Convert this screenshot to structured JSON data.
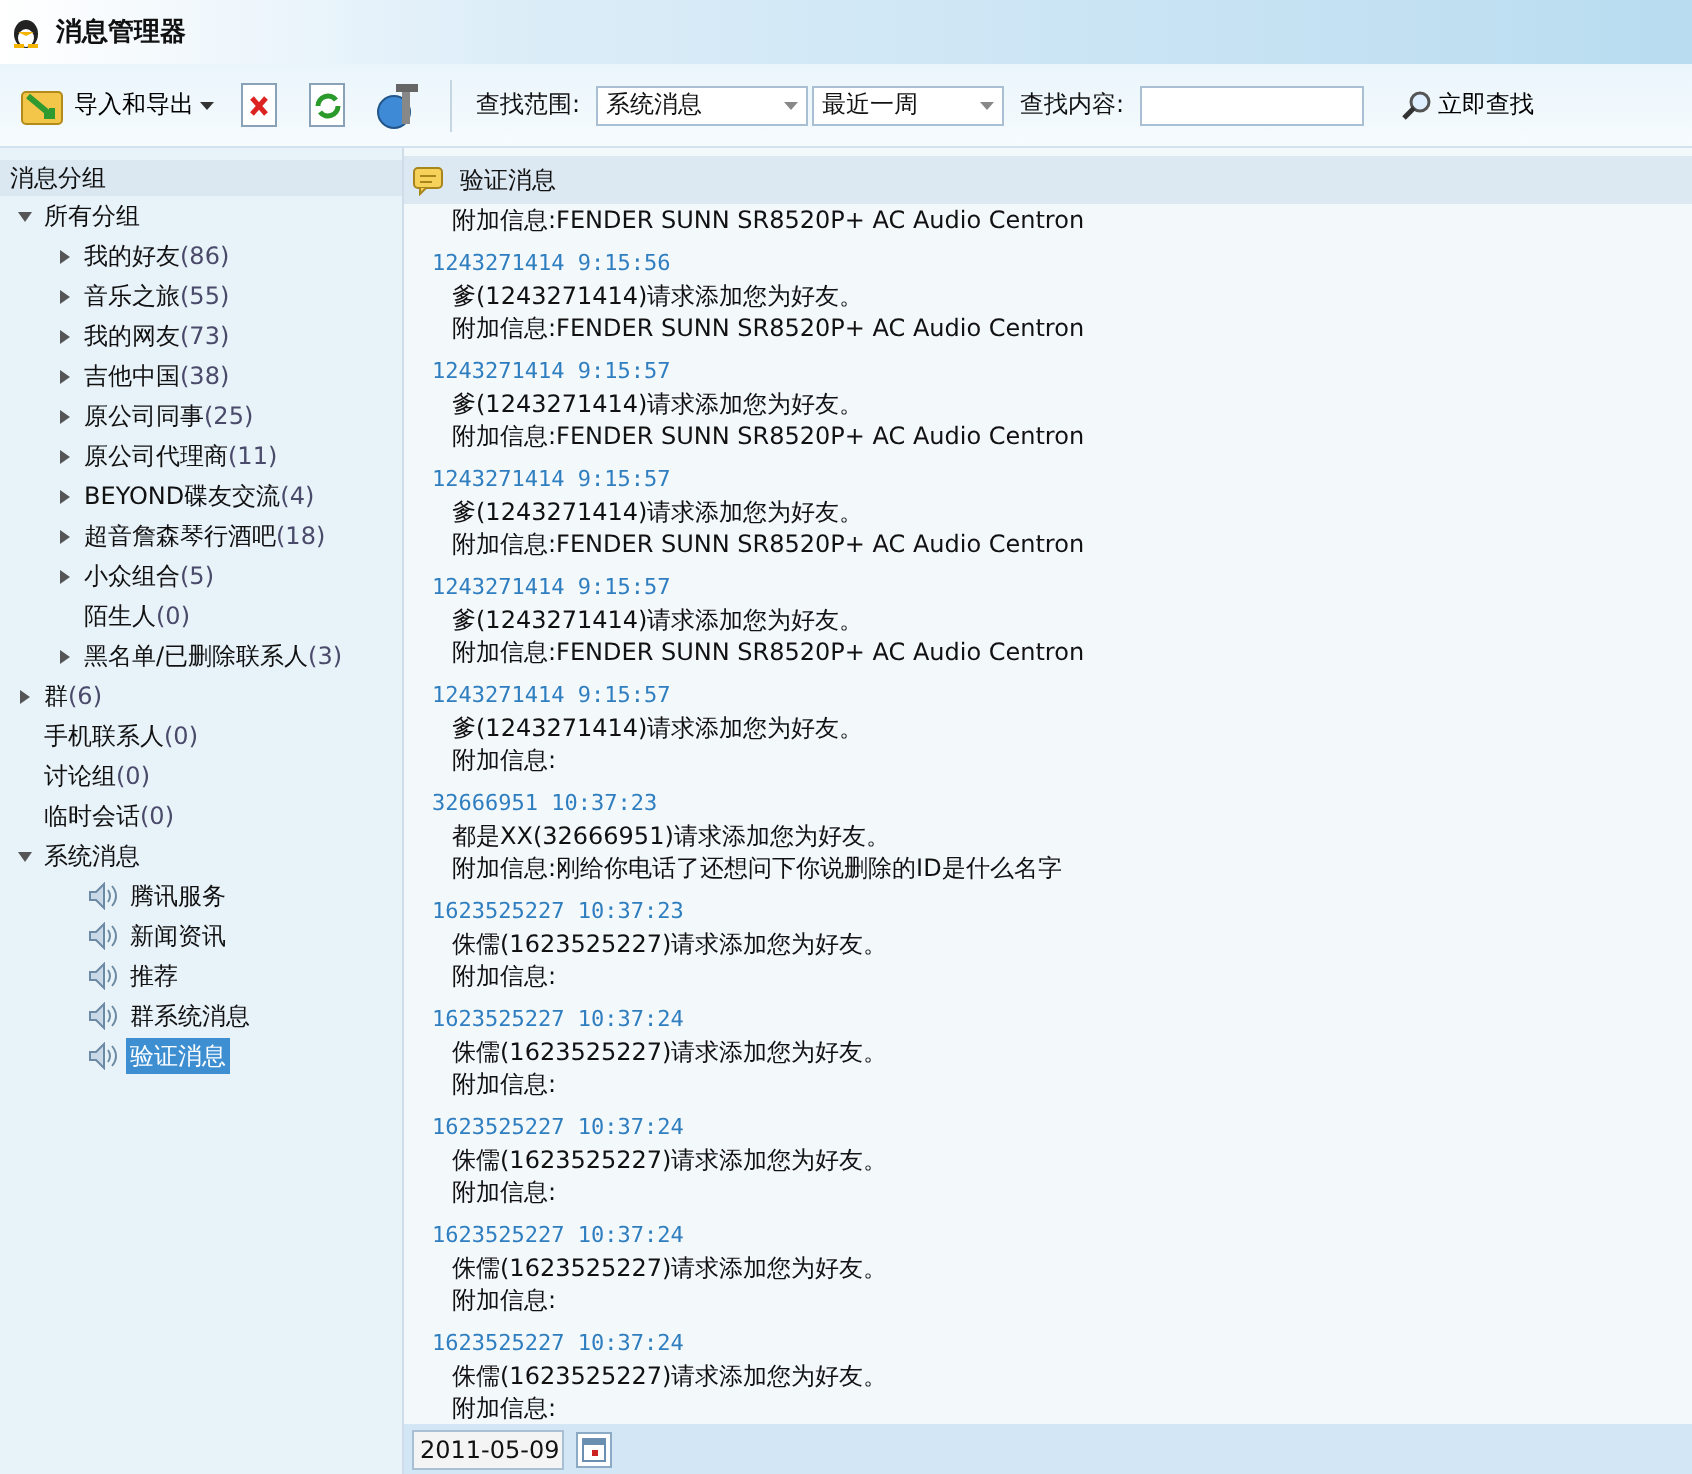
{
  "window": {
    "title": "消息管理器"
  },
  "toolbar": {
    "import_export": "导入和导出",
    "scope_label": "查找范围:",
    "scope_value": "系统消息",
    "period_value": "最近一周",
    "content_label": "查找内容:",
    "search_button": "立即查找"
  },
  "sidebar": {
    "title": "消息分组",
    "items": [
      {
        "kind": "group",
        "label": "所有分组",
        "expanded": true,
        "children": [
          {
            "kind": "group",
            "label": "我的好友",
            "count": "(86)",
            "expanded": false
          },
          {
            "kind": "group",
            "label": "音乐之旅",
            "count": "(55)",
            "expanded": false
          },
          {
            "kind": "group",
            "label": "我的网友",
            "count": "(73)",
            "expanded": false
          },
          {
            "kind": "group",
            "label": "吉他中国",
            "count": "(38)",
            "expanded": false
          },
          {
            "kind": "group",
            "label": "原公司同事",
            "count": "(25)",
            "expanded": false
          },
          {
            "kind": "group",
            "label": "原公司代理商",
            "count": "(11)",
            "expanded": false
          },
          {
            "kind": "group",
            "label": "BEYOND碟友交流",
            "count": "(4)",
            "expanded": false
          },
          {
            "kind": "group",
            "label": "超音詹森琴行酒吧",
            "count": "(18)",
            "expanded": false
          },
          {
            "kind": "group",
            "label": "小众组合",
            "count": "(5)",
            "expanded": false
          },
          {
            "kind": "plain",
            "label": "陌生人",
            "count": "(0)"
          },
          {
            "kind": "group",
            "label": "黑名单/已删除联系人",
            "count": "(3)",
            "expanded": false
          }
        ]
      },
      {
        "kind": "group",
        "label": "群",
        "count": "(6)",
        "expanded": false
      },
      {
        "kind": "plain",
        "label": "手机联系人",
        "count": "(0)"
      },
      {
        "kind": "plain",
        "label": "讨论组",
        "count": "(0)"
      },
      {
        "kind": "plain",
        "label": "临时会话",
        "count": "(0)"
      },
      {
        "kind": "group",
        "label": "系统消息",
        "expanded": true,
        "children": [
          {
            "kind": "channel",
            "label": "腾讯服务",
            "selected": false
          },
          {
            "kind": "channel",
            "label": "新闻资讯",
            "selected": false
          },
          {
            "kind": "channel",
            "label": "推荐",
            "selected": false
          },
          {
            "kind": "channel",
            "label": "群系统消息",
            "selected": false
          },
          {
            "kind": "channel",
            "label": "验证消息",
            "selected": true
          }
        ]
      }
    ]
  },
  "panel": {
    "title": "验证消息",
    "messages": [
      {
        "extra": "附加信息:FENDER SUNN SR8520P+ AC Audio Centron"
      },
      {
        "header": "1243271414  9:15:56",
        "request": "爹(1243271414)请求添加您为好友。",
        "extra": "附加信息:FENDER SUNN SR8520P+ AC Audio Centron"
      },
      {
        "header": "1243271414  9:15:57",
        "request": "爹(1243271414)请求添加您为好友。",
        "extra": "附加信息:FENDER SUNN SR8520P+ AC Audio Centron"
      },
      {
        "header": "1243271414  9:15:57",
        "request": "爹(1243271414)请求添加您为好友。",
        "extra": "附加信息:FENDER SUNN SR8520P+ AC Audio Centron"
      },
      {
        "header": "1243271414  9:15:57",
        "request": "爹(1243271414)请求添加您为好友。",
        "extra": "附加信息:FENDER SUNN SR8520P+ AC Audio Centron"
      },
      {
        "header": "1243271414  9:15:57",
        "request": "爹(1243271414)请求添加您为好友。",
        "extra": "附加信息:"
      },
      {
        "header": "32666951  10:37:23",
        "request": "都是XX(32666951)请求添加您为好友。",
        "extra": "附加信息:刚给你电话了还想问下你说删除的ID是什么名字"
      },
      {
        "header": "1623525227  10:37:23",
        "request": "侏儒(1623525227)请求添加您为好友。",
        "extra": "附加信息:"
      },
      {
        "header": "1623525227  10:37:24",
        "request": "侏儒(1623525227)请求添加您为好友。",
        "extra": "附加信息:"
      },
      {
        "header": "1623525227  10:37:24",
        "request": "侏儒(1623525227)请求添加您为好友。",
        "extra": "附加信息:"
      },
      {
        "header": "1623525227  10:37:24",
        "request": "侏儒(1623525227)请求添加您为好友。",
        "extra": "附加信息:"
      },
      {
        "header": "1623525227  10:37:24",
        "request": "侏儒(1623525227)请求添加您为好友。",
        "extra": "附加信息:"
      }
    ],
    "date": "2011-05-09"
  }
}
